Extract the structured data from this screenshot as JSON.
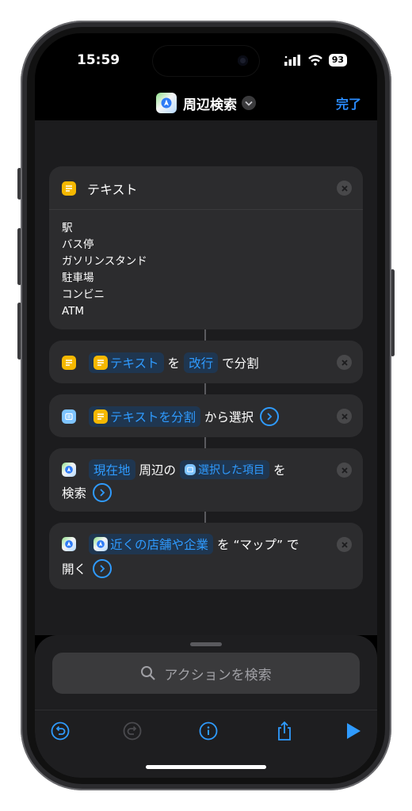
{
  "status": {
    "time": "15:59",
    "battery": "93"
  },
  "header": {
    "title": "周辺検索",
    "done_label": "完了"
  },
  "actions": {
    "text_card": {
      "title": "テキスト",
      "lines": [
        "駅",
        "バス停",
        "ガソリンスタンド",
        "駐車場",
        "コンビニ",
        "ATM"
      ]
    },
    "split": {
      "var": "テキスト",
      "w1": "を",
      "sep": "改行",
      "w2": "で分割"
    },
    "choose": {
      "var": "テキストを分割",
      "w1": "から選択"
    },
    "search": {
      "loc": "現在地",
      "w1": "周辺の",
      "item": "選択した項目",
      "w2": "を",
      "w3": "検索"
    },
    "open": {
      "var": "近くの店舗や企業",
      "w1": "を “マップ” で",
      "w2": "開く"
    }
  },
  "sheet": {
    "search_placeholder": "アクションを検索"
  },
  "colors": {
    "accent": "#2f9bff",
    "text_icon": "#f5b800",
    "card": "#2c2c2e",
    "canvas": "#1c1c1e"
  },
  "icons": [
    "maps-app-icon",
    "chevron-down-icon",
    "close-icon",
    "text-icon",
    "list-icon",
    "chevron-right-circle-icon",
    "search-icon",
    "undo-icon",
    "redo-icon",
    "info-icon",
    "share-icon",
    "play-icon",
    "signal-icon",
    "wifi-icon",
    "battery-icon"
  ]
}
